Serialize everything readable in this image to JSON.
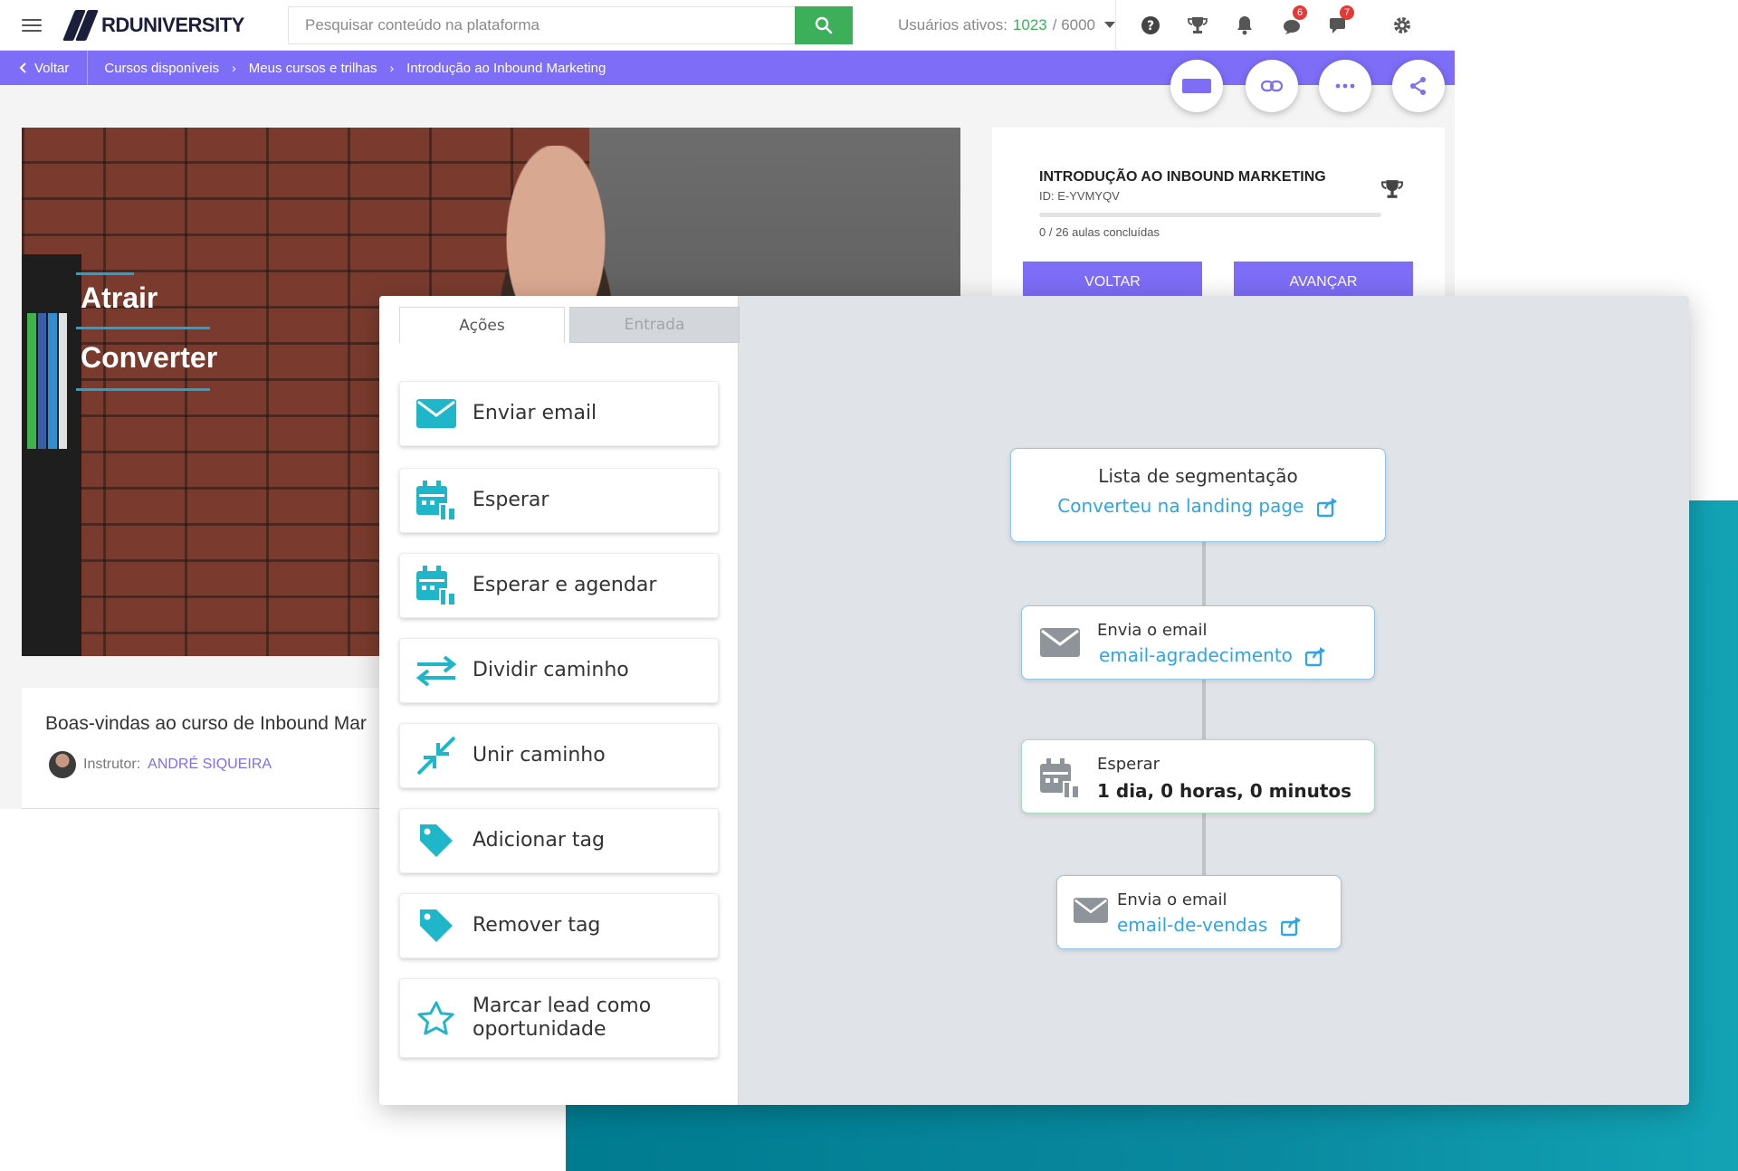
{
  "topbar": {
    "logo_brand": "RD",
    "logo_text": "UNIVERSITY",
    "search_placeholder": "Pesquisar conteúdo na plataforma",
    "users_label": "Usuários ativos:",
    "users_active": "1023",
    "users_total": "/ 6000",
    "badges": {
      "mentions": "6",
      "messages": "7"
    },
    "icons": [
      "menu-icon",
      "search-icon",
      "help-icon",
      "trophy-icon",
      "bell-icon",
      "mentions-icon",
      "messages-icon",
      "gear-icon"
    ]
  },
  "breadcrumb": {
    "back_label": "Voltar",
    "items": [
      "Cursos disponíveis",
      "Meus cursos e trilhas",
      "Introdução ao Inbound Marketing"
    ]
  },
  "video": {
    "overlay_lines": [
      "Atrair",
      "Converter"
    ]
  },
  "course": {
    "title": "INTRODUÇÃO AO INBOUND MARKETING",
    "id": "ID: E-YVMYQV",
    "progress_text": "0 / 26 aulas concluídas",
    "progress_fraction": 0,
    "back_button": "VOLTAR",
    "next_button": "AVANÇAR"
  },
  "lesson": {
    "title": "Boas-vindas ao curso de Inbound Mar",
    "instructor_label": "Instrutor:",
    "instructor_name": "ANDRÉ SIQUEIRA"
  },
  "automation": {
    "tabs": [
      "Ações",
      "Entrada"
    ],
    "actions": [
      {
        "label": "Enviar email",
        "icon": "envelope-icon"
      },
      {
        "label": "Esperar",
        "icon": "calendar-icon"
      },
      {
        "label": "Esperar e agendar",
        "icon": "calendar-icon"
      },
      {
        "label": "Dividir caminho",
        "icon": "split-arrows-icon"
      },
      {
        "label": "Unir caminho",
        "icon": "merge-arrows-icon"
      },
      {
        "label": "Adicionar tag",
        "icon": "tag-icon"
      },
      {
        "label": "Remover tag",
        "icon": "tag-icon"
      },
      {
        "label": "Marcar lead como oportunidade",
        "icon": "star-icon"
      }
    ],
    "flow": {
      "segment_title": "Lista de segmentação",
      "segment_link": "Converteu na landing page",
      "email1_label": "Envia o email",
      "email1_value": "email-agradecimento",
      "wait_label": "Esperar",
      "wait_value": "1 dia, 0 horas, 0 minutos",
      "email2_label": "Envia o email",
      "email2_value": "email-de-vendas"
    }
  },
  "colors": {
    "accent": "#7d6df7",
    "search_button": "#3daf5a",
    "action_icon": "#1fb6c9",
    "link": "#2ea5e8",
    "teal_background": "#0a8aa0"
  }
}
